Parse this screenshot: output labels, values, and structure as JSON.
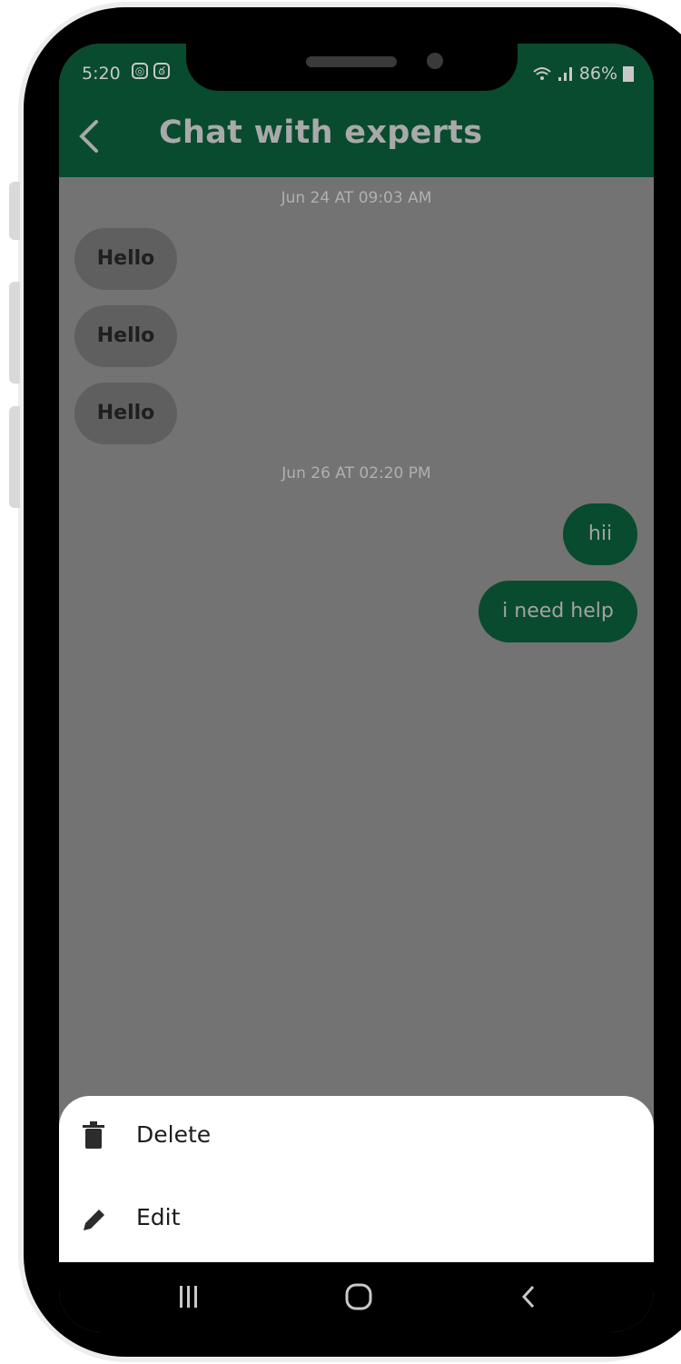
{
  "status_bar": {
    "time": "5:20",
    "signal_text": "⧫.∥",
    "battery": "86%"
  },
  "header": {
    "title": "Chat with experts"
  },
  "messages": {
    "timestamp_1": "Jun 24 AT 09:03 AM",
    "incoming": [
      "Hello",
      "Hello",
      "Hello"
    ],
    "timestamp_2": "Jun 26 AT 02:20 PM",
    "outgoing": [
      "hii",
      "i need help"
    ]
  },
  "action_sheet": {
    "items": [
      {
        "label": "Delete",
        "icon": "trash-icon"
      },
      {
        "label": "Edit",
        "icon": "pencil-icon"
      }
    ]
  },
  "nav_bar": {
    "buttons": [
      "recent-apps",
      "home",
      "back"
    ]
  },
  "colors": {
    "brand": "#094b2e",
    "overlay": "#737373",
    "sheet": "#ffffff"
  }
}
